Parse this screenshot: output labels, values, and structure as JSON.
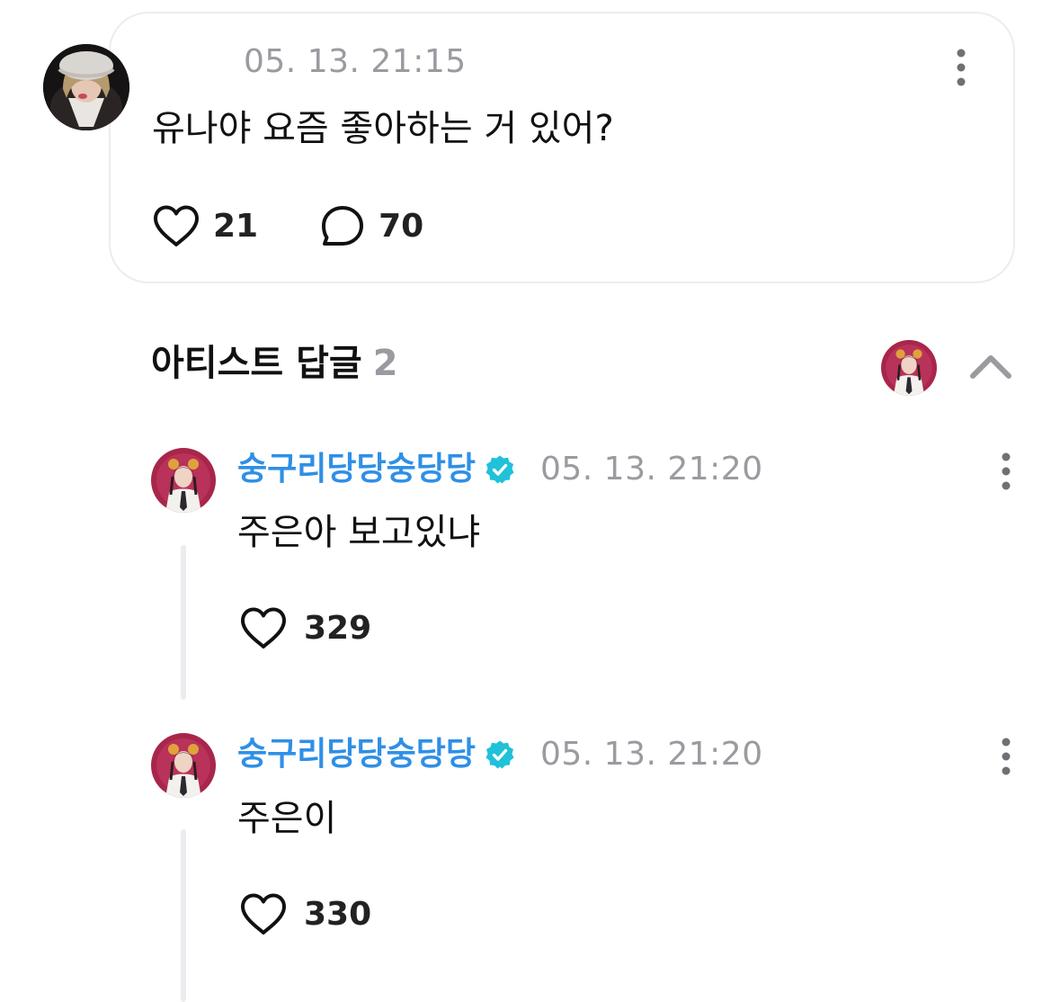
{
  "post": {
    "timestamp": "05. 13. 21:15",
    "text": "유나야 요즘 좋아하는 거 있어?",
    "like_count": "21",
    "comment_count": "70"
  },
  "artist_replies": {
    "title": "아티스트 답글",
    "count": "2",
    "items": [
      {
        "author": "숭구리당당숭당당",
        "timestamp": "05. 13. 21:20",
        "text": "주은아 보고있냐",
        "like_count": "329"
      },
      {
        "author": "숭구리당당숭당당",
        "timestamp": "05. 13. 21:20",
        "text": "주은이",
        "like_count": "330"
      }
    ]
  },
  "icons": {
    "like": "heart-icon",
    "comment": "speech-bubble-icon",
    "more": "more-vertical-icon",
    "verified": "verified-badge-icon",
    "collapse": "chevron-up-icon"
  },
  "colors": {
    "author_name": "#2f8fe6",
    "verified_badge": "#1fc2d9",
    "muted_text": "#9a9aa0",
    "card_border": "#ececf0"
  }
}
